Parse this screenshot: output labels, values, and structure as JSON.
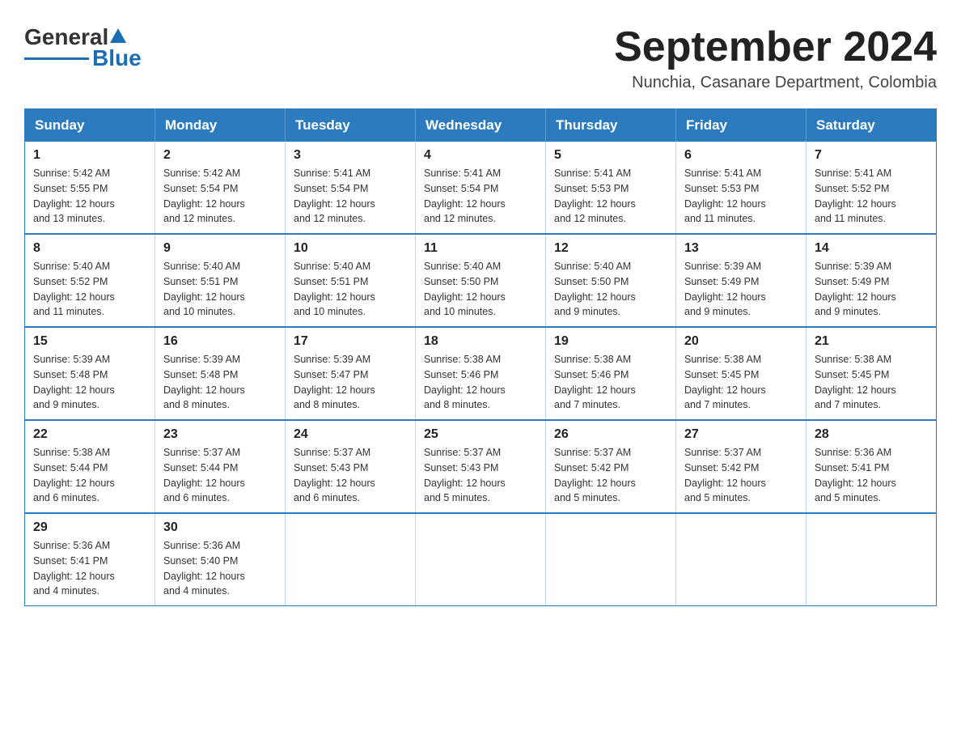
{
  "logo": {
    "general": "General",
    "blue": "Blue"
  },
  "header": {
    "month": "September 2024",
    "location": "Nunchia, Casanare Department, Colombia"
  },
  "weekdays": [
    "Sunday",
    "Monday",
    "Tuesday",
    "Wednesday",
    "Thursday",
    "Friday",
    "Saturday"
  ],
  "weeks": [
    [
      {
        "day": "1",
        "sunrise": "5:42 AM",
        "sunset": "5:55 PM",
        "daylight": "12 hours and 13 minutes."
      },
      {
        "day": "2",
        "sunrise": "5:42 AM",
        "sunset": "5:54 PM",
        "daylight": "12 hours and 12 minutes."
      },
      {
        "day": "3",
        "sunrise": "5:41 AM",
        "sunset": "5:54 PM",
        "daylight": "12 hours and 12 minutes."
      },
      {
        "day": "4",
        "sunrise": "5:41 AM",
        "sunset": "5:54 PM",
        "daylight": "12 hours and 12 minutes."
      },
      {
        "day": "5",
        "sunrise": "5:41 AM",
        "sunset": "5:53 PM",
        "daylight": "12 hours and 12 minutes."
      },
      {
        "day": "6",
        "sunrise": "5:41 AM",
        "sunset": "5:53 PM",
        "daylight": "12 hours and 11 minutes."
      },
      {
        "day": "7",
        "sunrise": "5:41 AM",
        "sunset": "5:52 PM",
        "daylight": "12 hours and 11 minutes."
      }
    ],
    [
      {
        "day": "8",
        "sunrise": "5:40 AM",
        "sunset": "5:52 PM",
        "daylight": "12 hours and 11 minutes."
      },
      {
        "day": "9",
        "sunrise": "5:40 AM",
        "sunset": "5:51 PM",
        "daylight": "12 hours and 10 minutes."
      },
      {
        "day": "10",
        "sunrise": "5:40 AM",
        "sunset": "5:51 PM",
        "daylight": "12 hours and 10 minutes."
      },
      {
        "day": "11",
        "sunrise": "5:40 AM",
        "sunset": "5:50 PM",
        "daylight": "12 hours and 10 minutes."
      },
      {
        "day": "12",
        "sunrise": "5:40 AM",
        "sunset": "5:50 PM",
        "daylight": "12 hours and 9 minutes."
      },
      {
        "day": "13",
        "sunrise": "5:39 AM",
        "sunset": "5:49 PM",
        "daylight": "12 hours and 9 minutes."
      },
      {
        "day": "14",
        "sunrise": "5:39 AM",
        "sunset": "5:49 PM",
        "daylight": "12 hours and 9 minutes."
      }
    ],
    [
      {
        "day": "15",
        "sunrise": "5:39 AM",
        "sunset": "5:48 PM",
        "daylight": "12 hours and 9 minutes."
      },
      {
        "day": "16",
        "sunrise": "5:39 AM",
        "sunset": "5:48 PM",
        "daylight": "12 hours and 8 minutes."
      },
      {
        "day": "17",
        "sunrise": "5:39 AM",
        "sunset": "5:47 PM",
        "daylight": "12 hours and 8 minutes."
      },
      {
        "day": "18",
        "sunrise": "5:38 AM",
        "sunset": "5:46 PM",
        "daylight": "12 hours and 8 minutes."
      },
      {
        "day": "19",
        "sunrise": "5:38 AM",
        "sunset": "5:46 PM",
        "daylight": "12 hours and 7 minutes."
      },
      {
        "day": "20",
        "sunrise": "5:38 AM",
        "sunset": "5:45 PM",
        "daylight": "12 hours and 7 minutes."
      },
      {
        "day": "21",
        "sunrise": "5:38 AM",
        "sunset": "5:45 PM",
        "daylight": "12 hours and 7 minutes."
      }
    ],
    [
      {
        "day": "22",
        "sunrise": "5:38 AM",
        "sunset": "5:44 PM",
        "daylight": "12 hours and 6 minutes."
      },
      {
        "day": "23",
        "sunrise": "5:37 AM",
        "sunset": "5:44 PM",
        "daylight": "12 hours and 6 minutes."
      },
      {
        "day": "24",
        "sunrise": "5:37 AM",
        "sunset": "5:43 PM",
        "daylight": "12 hours and 6 minutes."
      },
      {
        "day": "25",
        "sunrise": "5:37 AM",
        "sunset": "5:43 PM",
        "daylight": "12 hours and 5 minutes."
      },
      {
        "day": "26",
        "sunrise": "5:37 AM",
        "sunset": "5:42 PM",
        "daylight": "12 hours and 5 minutes."
      },
      {
        "day": "27",
        "sunrise": "5:37 AM",
        "sunset": "5:42 PM",
        "daylight": "12 hours and 5 minutes."
      },
      {
        "day": "28",
        "sunrise": "5:36 AM",
        "sunset": "5:41 PM",
        "daylight": "12 hours and 5 minutes."
      }
    ],
    [
      {
        "day": "29",
        "sunrise": "5:36 AM",
        "sunset": "5:41 PM",
        "daylight": "12 hours and 4 minutes."
      },
      {
        "day": "30",
        "sunrise": "5:36 AM",
        "sunset": "5:40 PM",
        "daylight": "12 hours and 4 minutes."
      },
      null,
      null,
      null,
      null,
      null
    ]
  ],
  "labels": {
    "sunrise": "Sunrise:",
    "sunset": "Sunset:",
    "daylight": "Daylight:"
  }
}
